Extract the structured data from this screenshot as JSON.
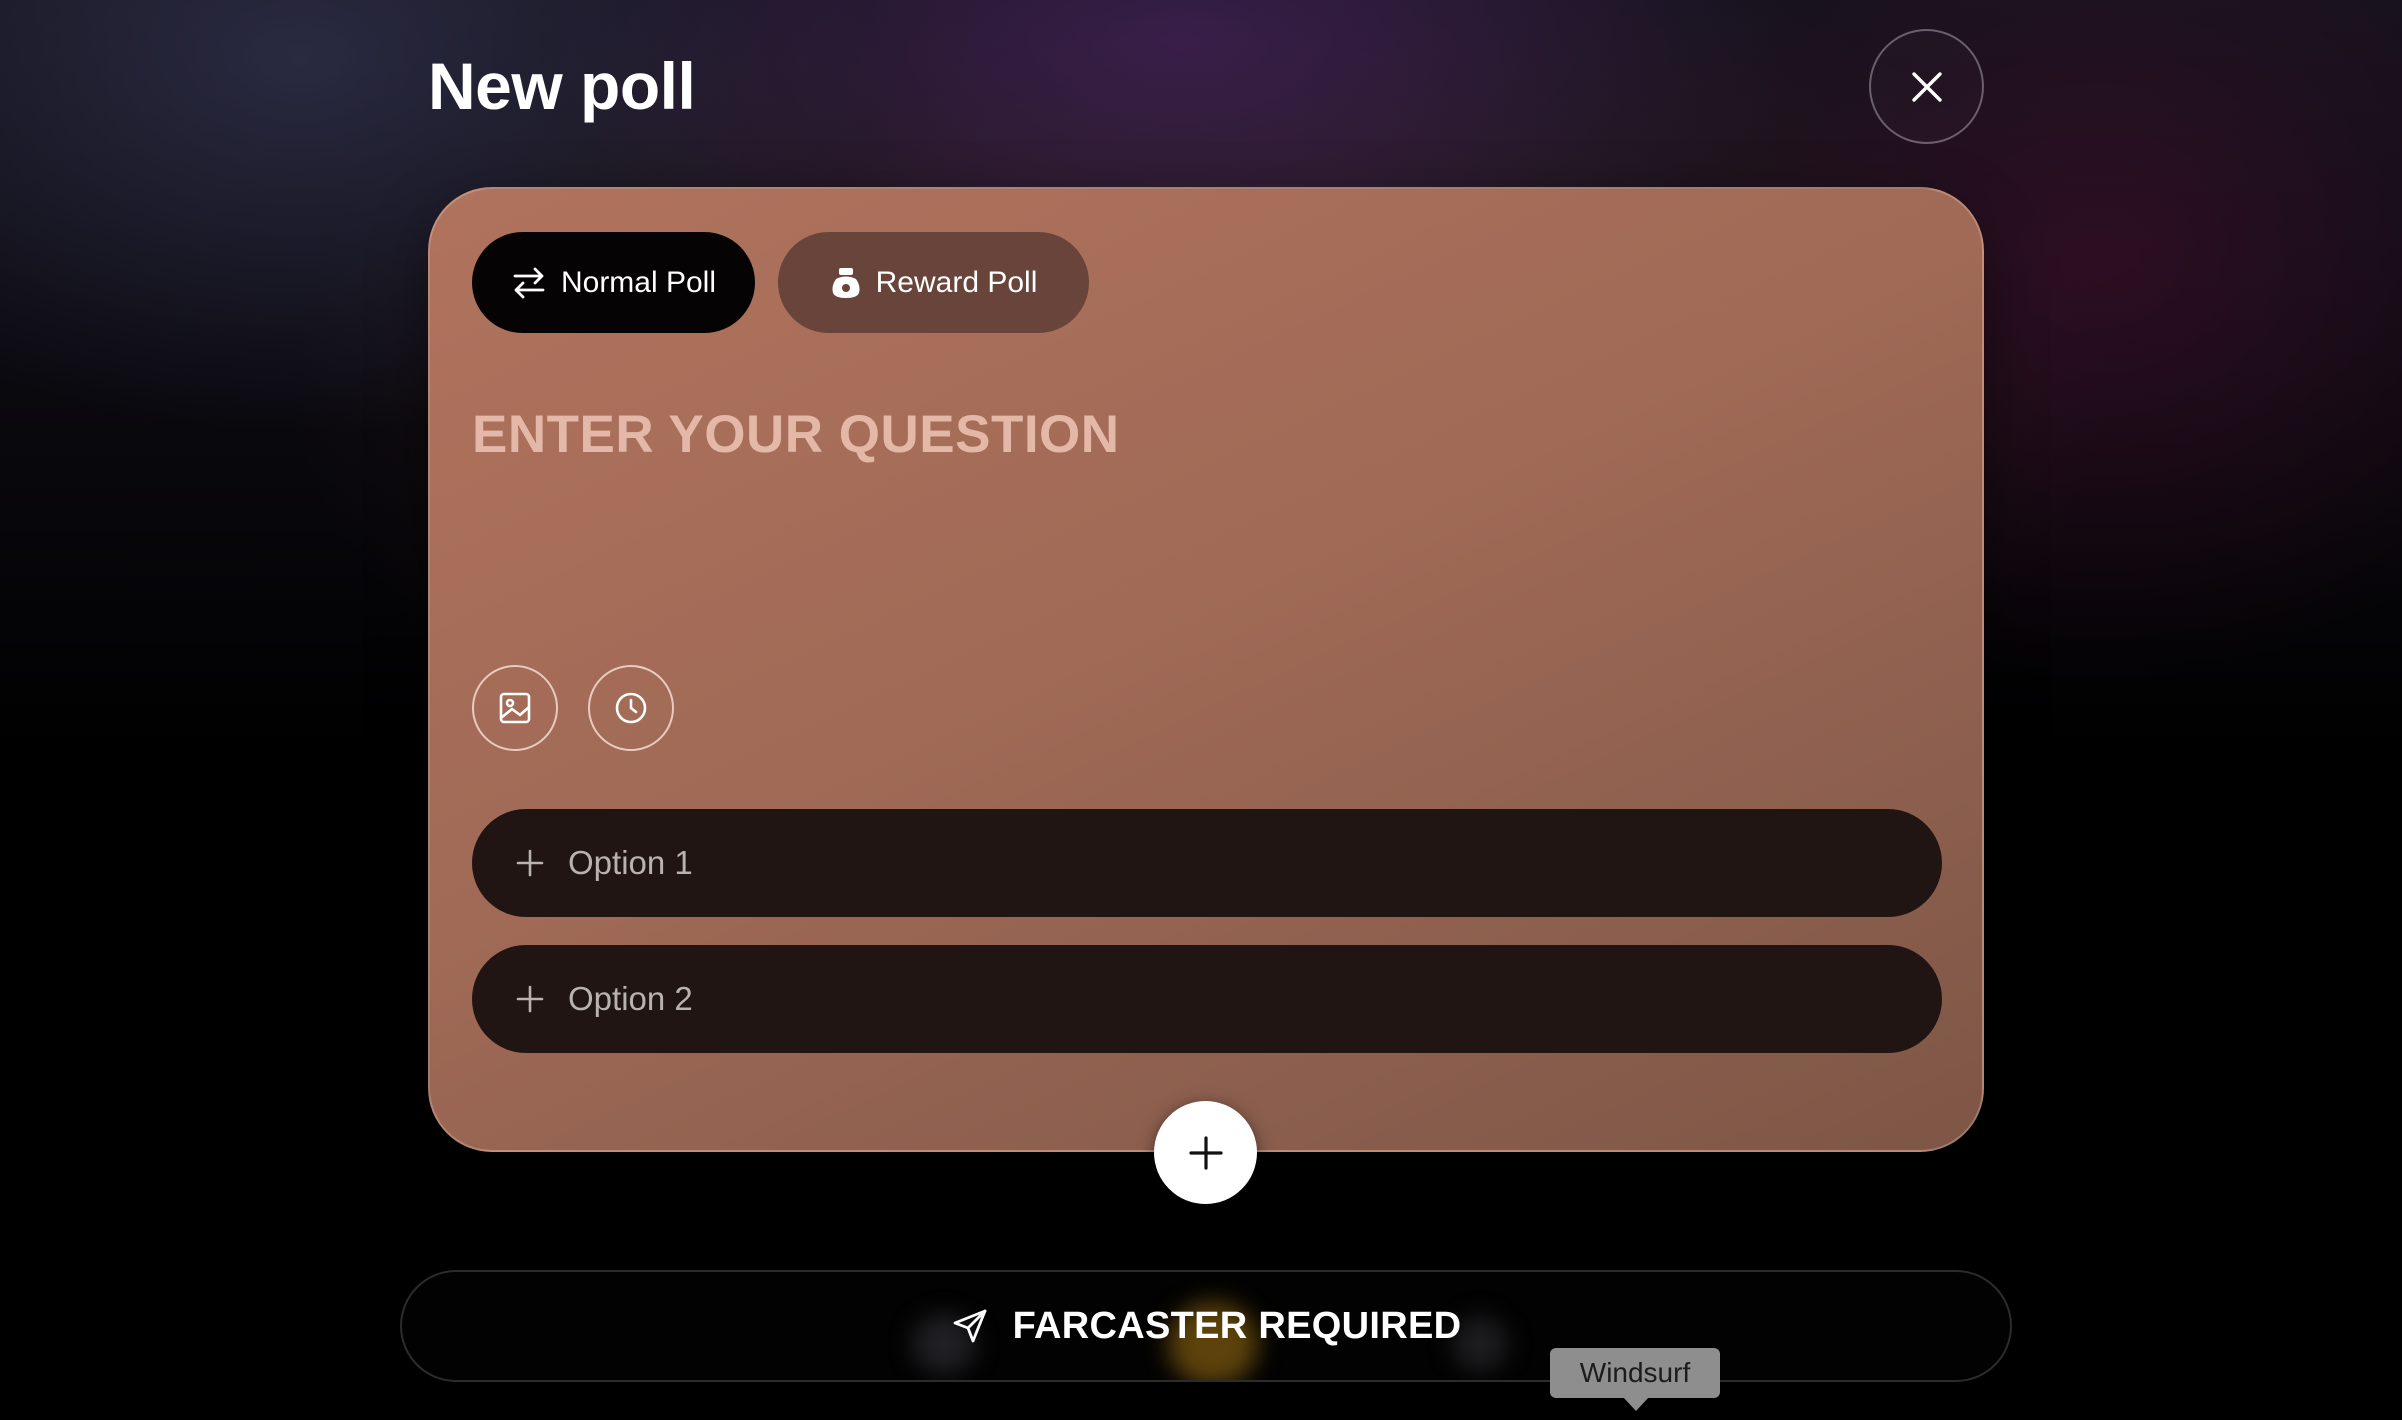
{
  "header": {
    "title": "New poll",
    "close_icon": "close-icon"
  },
  "poll_card": {
    "tabs": [
      {
        "label": "Normal Poll",
        "icon": "swap-arrows-icon",
        "selected": true
      },
      {
        "label": "Reward Poll",
        "icon": "money-bag-icon",
        "selected": false
      }
    ],
    "question_placeholder": "ENTER YOUR QUESTION",
    "tools": [
      {
        "icon": "image-icon"
      },
      {
        "icon": "clock-icon"
      }
    ],
    "options": [
      {
        "placeholder": "Option 1",
        "icon": "plus-icon"
      },
      {
        "placeholder": "Option 2",
        "icon": "plus-icon"
      }
    ],
    "add_option_icon": "plus-icon"
  },
  "submit": {
    "label": "FARCASTER REQUIRED",
    "icon": "send-icon"
  },
  "tooltip": {
    "text": "Windsurf"
  },
  "colors": {
    "card": "#a06a56",
    "selected_tab": "#050303",
    "unselected_tab": "#68443a",
    "option_row": "#201512",
    "question_placeholder": "#f5cdbe"
  }
}
